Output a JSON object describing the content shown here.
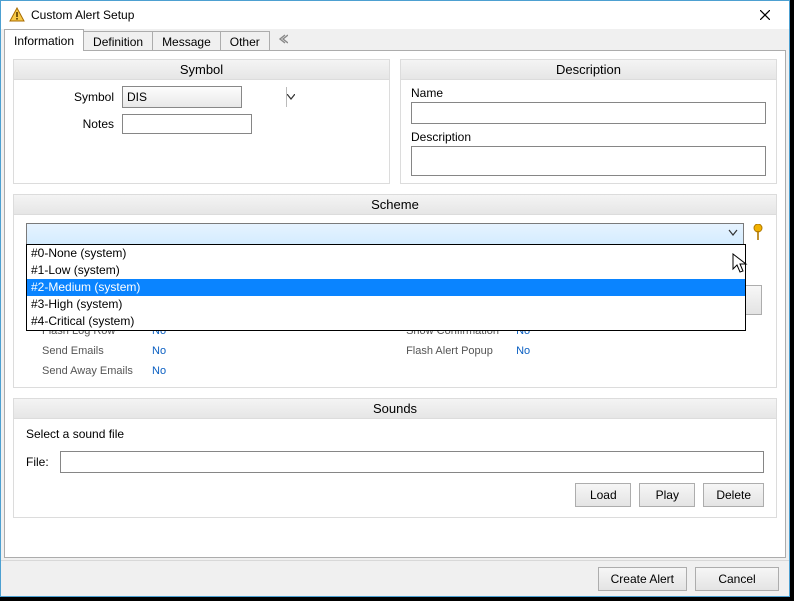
{
  "window": {
    "title": "Custom Alert Setup",
    "icon": "warning-icon"
  },
  "tabs": [
    "Information",
    "Definition",
    "Message",
    "Other"
  ],
  "active_tab": 0,
  "symbol_panel": {
    "title": "Symbol",
    "symbol_label": "Symbol",
    "symbol_value": "DIS",
    "notes_label": "Notes",
    "notes_value": ""
  },
  "description_panel": {
    "title": "Description",
    "name_label": "Name",
    "name_value": "",
    "desc_label": "Description",
    "desc_value": ""
  },
  "scheme_panel": {
    "title": "Scheme",
    "selected_value": "",
    "dropdown_options": [
      "#0-None (system)",
      "#1-Low (system)",
      "#2-Medium (system)",
      "#3-High (system)",
      "#4-Critical (system)"
    ],
    "dropdown_selected_index": 2,
    "props_left": [
      {
        "label": "Flash Log Row",
        "value": "No"
      },
      {
        "label": "Send Emails",
        "value": "No"
      },
      {
        "label": "Send Away Emails",
        "value": "No"
      }
    ],
    "props_right": [
      {
        "label": "Show Confirmation",
        "value": "No"
      },
      {
        "label": "Flash Alert Popup",
        "value": "No"
      }
    ]
  },
  "sounds_panel": {
    "title": "Sounds",
    "select_label": "Select a sound file",
    "file_label": "File:",
    "file_value": "",
    "load_btn": "Load",
    "play_btn": "Play",
    "delete_btn": "Delete"
  },
  "footer": {
    "create": "Create Alert",
    "cancel": "Cancel"
  }
}
